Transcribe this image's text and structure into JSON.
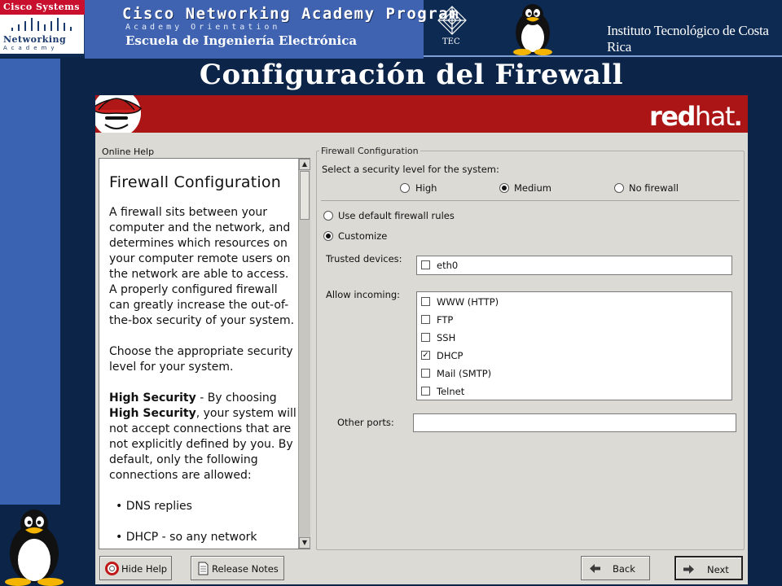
{
  "slide": {
    "cisco_logo_top": "Cisco Systems",
    "cisco_logo_line1": "Networking",
    "cisco_logo_line2": "Academy",
    "banner_title": "Cisco Networking Academy Program",
    "banner_subtitle": "Academy Orientation",
    "banner_school": "Escuela de Ingeniería Electrónica",
    "tec_label": "TEC",
    "institution": "Instituto Tecnológico de Costa Rica",
    "title": "Configuración del Firewall"
  },
  "installer": {
    "brand": {
      "bold": "red",
      "thin": "hat",
      "dot": "."
    },
    "help": {
      "caption": "Online Help",
      "heading": "Firewall Configuration",
      "para1": "A firewall sits between your computer and the network, and determines which resources on your computer remote users on the network are able to access. A properly configured firewall can greatly increase the out-of-the-box security of your system.",
      "para2": "Choose the appropriate security level for your system.",
      "para3_bold1": "High Security",
      "para3_text1": " - By choosing ",
      "para3_bold2": "High Security",
      "para3_text2": ", your system will not accept connections that are not explicitly defined by you. By default, only the following connections are allowed:",
      "bullets": [
        "• DNS replies",
        "• DHCP - so any network"
      ]
    },
    "firewall": {
      "caption": "Firewall Configuration",
      "prompt": "Select a security level for the system:",
      "levels": [
        {
          "label": "High",
          "selected": false
        },
        {
          "label": "Medium",
          "selected": true
        },
        {
          "label": "No firewall",
          "selected": false
        }
      ],
      "rules": [
        {
          "label": "Use default firewall rules",
          "selected": false
        },
        {
          "label": "Customize",
          "selected": true
        }
      ],
      "trusted_label": "Trusted devices:",
      "trusted_devices": [
        {
          "label": "eth0",
          "checked": false
        }
      ],
      "incoming_label": "Allow incoming:",
      "incoming": [
        {
          "label": "WWW (HTTP)",
          "checked": false
        },
        {
          "label": "FTP",
          "checked": false
        },
        {
          "label": "SSH",
          "checked": false
        },
        {
          "label": "DHCP",
          "checked": true
        },
        {
          "label": "Mail (SMTP)",
          "checked": false
        },
        {
          "label": "Telnet",
          "checked": false
        }
      ],
      "other_ports_label": "Other ports:",
      "other_ports_value": ""
    },
    "buttons": {
      "hide_help": "Hide Help",
      "release_notes": "Release Notes",
      "back": "Back",
      "next": "Next"
    }
  },
  "colors": {
    "slide_background": "#0b2447",
    "slide_accent_blue": "#3a63b2",
    "redhat_red": "#ab1515",
    "gtk_gray": "#dcdad5"
  }
}
